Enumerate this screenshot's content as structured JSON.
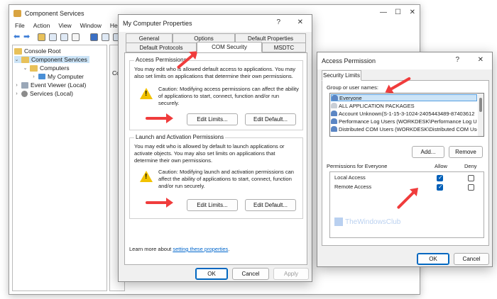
{
  "mmc": {
    "title": "Component Services",
    "menu": [
      "File",
      "Action",
      "View",
      "Window",
      "He"
    ],
    "tree": {
      "root": "Console Root",
      "component_services": "Component Services",
      "computers": "Computers",
      "my_computer": "My Computer",
      "event_viewer": "Event Viewer (Local)",
      "services": "Services (Local)"
    },
    "pane_stub": "Co"
  },
  "props": {
    "title": "My Computer Properties",
    "help": "?",
    "close": "✕",
    "tabs_row1": [
      "General",
      "Options",
      "Default Properties"
    ],
    "tabs_row2": [
      "Default Protocols",
      "COM Security",
      "MSDTC"
    ],
    "access": {
      "title": "Access Permissions",
      "desc": "You may edit who is allowed default access to applications. You may also set limits on applications that determine their own permissions.",
      "caution": "Caution: Modifying access permissions can affect the ability of applications to start, connect, function and/or run securely.",
      "edit_limits": "Edit Limits...",
      "edit_default": "Edit Default..."
    },
    "launch": {
      "title": "Launch and Activation Permissions",
      "desc": "You may edit who is allowed by default to launch applications or activate objects. You may also set limits on applications that determine their own permissions.",
      "caution": "Caution: Modifying launch and activation permissions can affect the ability of applications to start, connect, function and/or run securely.",
      "edit_limits": "Edit Limits...",
      "edit_default": "Edit Default..."
    },
    "learn_prefix": "Learn more about",
    "learn_link": "setting these properties",
    "learn_suffix": ".",
    "ok": "OK",
    "cancel": "Cancel",
    "apply": "Apply"
  },
  "access_perm": {
    "title": "Access Permission",
    "help": "?",
    "close": "✕",
    "tab": "Security Limits",
    "group_label": "Group or user names:",
    "users": [
      "Everyone",
      "ALL APPLICATION PACKAGES",
      "Account Unknown(S-1-15-3-1024-2405443489-87403612",
      "Performance Log Users (WORKDESK\\Performance Log U",
      "Distributed COM Users (WORKDESK\\Distributed COM Use"
    ],
    "add": "Add...",
    "remove": "Remove",
    "perm_label": "Permissions for Everyone",
    "allow": "Allow",
    "deny": "Deny",
    "perms": [
      {
        "name": "Local Access",
        "allow": true,
        "deny": false
      },
      {
        "name": "Remote Access",
        "allow": true,
        "deny": false
      }
    ],
    "watermark": "TheWindowsClub",
    "ok": "OK",
    "cancel": "Cancel"
  }
}
